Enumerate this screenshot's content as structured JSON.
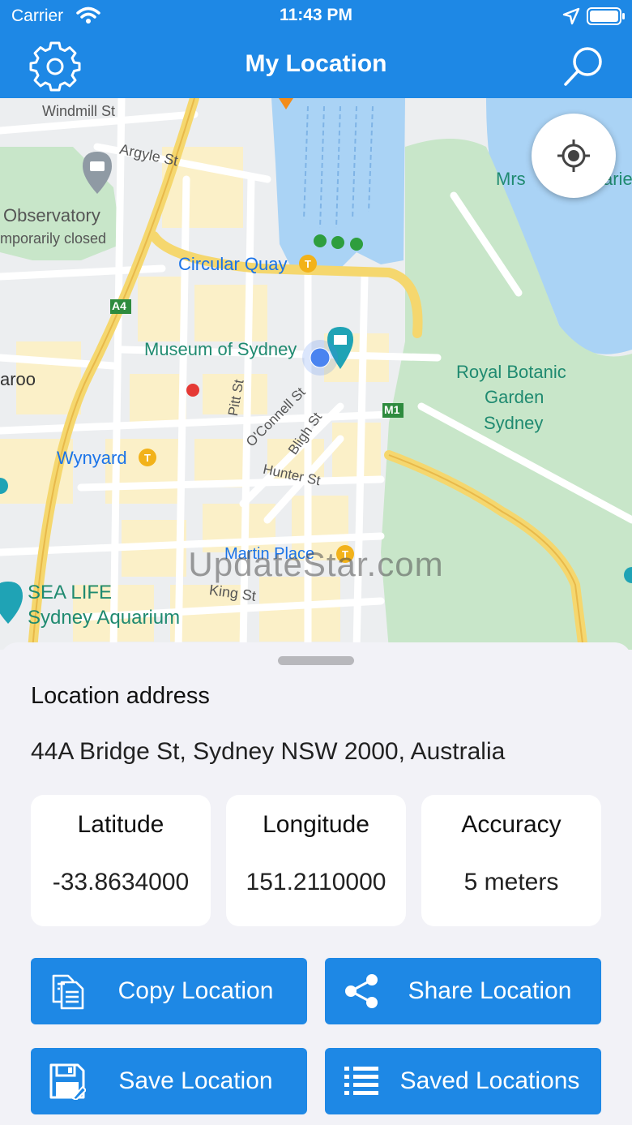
{
  "status_bar": {
    "carrier": "Carrier",
    "time": "11:43 PM"
  },
  "nav": {
    "title": "My Location"
  },
  "map": {
    "labels": {
      "windmill": "Windmill St",
      "argyle": "Argyle St",
      "observatory": "Observatory",
      "temp_closed": "mporarily closed",
      "circular_quay": "Circular Quay",
      "a4": "A4",
      "museum": "Museum of Sydney",
      "aroo": "aroo",
      "royal": "Royal Botanic",
      "garden": "Garden",
      "sydney": "Sydney",
      "m1": "M1",
      "pitt": "Pitt St",
      "oconnell": "O'Connell St",
      "bligh": "Bligh St",
      "hunter": "Hunter St",
      "wynyard": "Wynyard",
      "martin": "Martin Place",
      "king": "King St",
      "sealife1": "SEA LIFE",
      "sealife2": "Sydney Aquarium",
      "mrs": "Mrs",
      "arie": "arie"
    },
    "watermark": "UpdateStar.com"
  },
  "sheet": {
    "address_heading": "Location address",
    "address": "44A Bridge St, Sydney NSW 2000, Australia",
    "cards": [
      {
        "label": "Latitude",
        "value": "-33.8634000"
      },
      {
        "label": "Longitude",
        "value": "151.2110000"
      },
      {
        "label": "Accuracy",
        "value": "5 meters"
      }
    ],
    "buttons": {
      "copy": "Copy Location",
      "share": "Share Location",
      "save": "Save Location",
      "saved": "Saved Locations"
    }
  },
  "colors": {
    "accent": "#1e88e5",
    "background": "#f2f2f7",
    "water": "#aad3f5",
    "park": "#c8e6c9"
  }
}
